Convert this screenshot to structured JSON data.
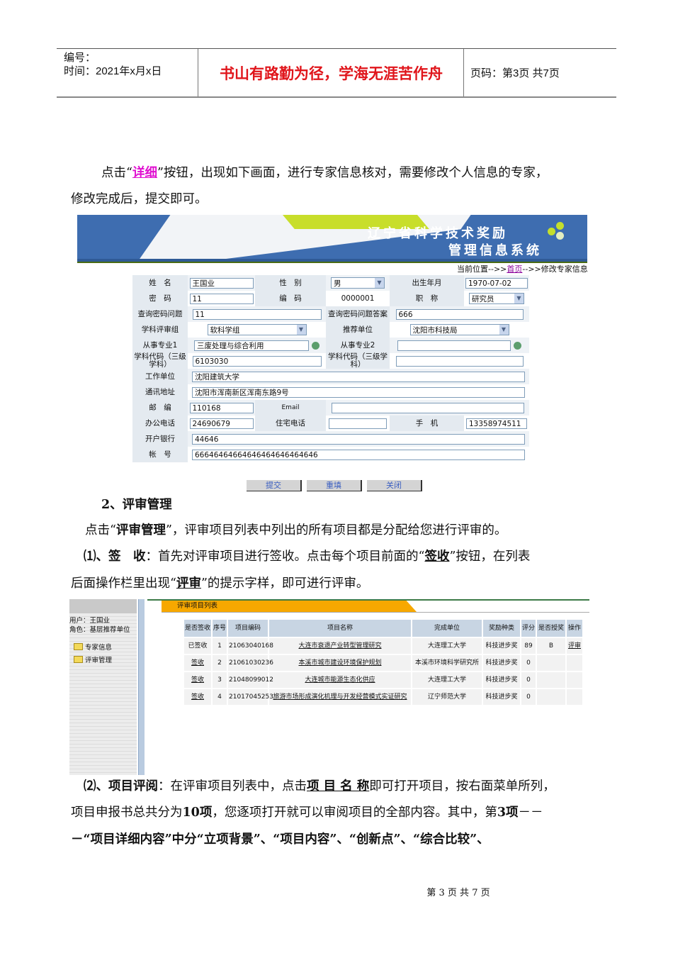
{
  "header": {
    "number_label": "编号：",
    "date_label": "时间：2021年x月x日",
    "motto": "书山有路勤为径，学海无涯苦作舟",
    "page_label": "页码：第3页 共7页"
  },
  "para1": {
    "pre": "点击“",
    "link": "详细",
    "post": "”按钮，出现如下画面，进行专家信息核对，需要修改个人信息的专家，",
    "line2": "修改完成后，提交即可。"
  },
  "banner": {
    "title1": "辽宁省科学技术奖励",
    "title2": "管理信息系统"
  },
  "location": {
    "prefix": "当前位置-->>",
    "home": "首页",
    "suffix": "-->>修改专家信息"
  },
  "form": {
    "name_label": "姓　名",
    "name": "王国业",
    "gender_label": "性　别",
    "gender": "男",
    "birth_label": "出生年月",
    "birth": "1970-07-02",
    "pwd_label": "密　码",
    "pwd": "11",
    "code_label": "编　码",
    "code": "0000001",
    "title_label": "职　称",
    "title": "研究员",
    "q_label": "查询密码问题",
    "q": "11",
    "a_label": "查询密码问题答案",
    "a": "666",
    "group_label": "学科评审组",
    "group": "软科学组",
    "rec_label": "推荐单位",
    "rec": "沈阳市科技局",
    "major1_label": "从事专业1",
    "major1": "三废处理与综合利用",
    "major2_label": "从事专业2",
    "major2": "",
    "sub1_label": "学科代码（三级学科）",
    "sub1": "6103030",
    "sub2_label": "学科代码（三级学科）",
    "sub2": "",
    "work_label": "工作单位",
    "work": "沈阳建筑大学",
    "addr_label": "通讯地址",
    "addr": "沈阳市浑南新区浑南东路9号",
    "zip_label": "邮　编",
    "zip": "110168",
    "email_label": "Email",
    "email": "",
    "office_label": "办公电话",
    "office": "24690679",
    "home_label": "住宅电话",
    "home": "",
    "mobile_label": "手　机",
    "mobile": "13358974511",
    "bank_label": "开户银行",
    "bank": "44646",
    "acct_label": "帐　号",
    "acct": "66646464664646464646464646",
    "submit": "提交",
    "reset": "重填",
    "close": "关闭"
  },
  "section2": {
    "heading": "2、评审管理",
    "p1_pre": "点击“",
    "p1_bold": "评审管理",
    "p1_post": "”，评审项目列表中列出的所有项目都是分配给您进行评审的。",
    "p2_a": "⑴、签　收",
    "p2_b": "：首先对评审项目进行签收。点击每个项目前面的“",
    "p2_c": "签收",
    "p2_d": "”按钮，在列表",
    "p2_line2_a": "后面操作栏里出现“",
    "p2_line2_b": "评审",
    "p2_line2_c": "”的提示字样，即可进行评审。"
  },
  "review": {
    "user": "用户：王国业",
    "role": "角色：基层推荐单位",
    "menu": [
      "专家信息",
      "评审管理"
    ],
    "tab": "评审项目列表",
    "columns": [
      "是否签收",
      "序号",
      "项目编码",
      "项目名称",
      "完成单位",
      "奖励种类",
      "评分",
      "是否授奖",
      "操作"
    ],
    "rows": [
      [
        "已签收",
        "1",
        "21063040168",
        "大连市衰退产业转型管理研究",
        "大连理工大学",
        "科技进步奖",
        "89",
        "B",
        "评审"
      ],
      [
        "签收",
        "2",
        "21061030236",
        "本溪市城市建设环境保护规划",
        "本溪市环境科学研究所",
        "科技进步奖",
        "0",
        "",
        ""
      ],
      [
        "签收",
        "3",
        "21048099012",
        "大连城市能源生态化供应",
        "大连理工大学",
        "科技进步奖",
        "0",
        "",
        ""
      ],
      [
        "签收",
        "4",
        "21017045253",
        "旅游市场形成演化机理与开发经营模式实证研究",
        "辽宁师范大学",
        "科技进步奖",
        "0",
        "",
        ""
      ]
    ]
  },
  "para3": {
    "a": "⑵、项目评阅",
    "b": "：在评审项目列表中，点击",
    "c": "项 目 名 称",
    "d": "即可打开项目，按右面菜单所列，",
    "l2a": "项目申报书总共分为",
    "l2b": "10项",
    "l2c": "，您逐项打开就可以审阅项目的全部内容。其中，第",
    "l2d": "3项",
    "l2e": "－－",
    "l3": "－“项目详细内容”中分“立项背景”、“项目内容”、“创新点”、“综合比较”、"
  },
  "footer": "第 3 页 共 7 页"
}
